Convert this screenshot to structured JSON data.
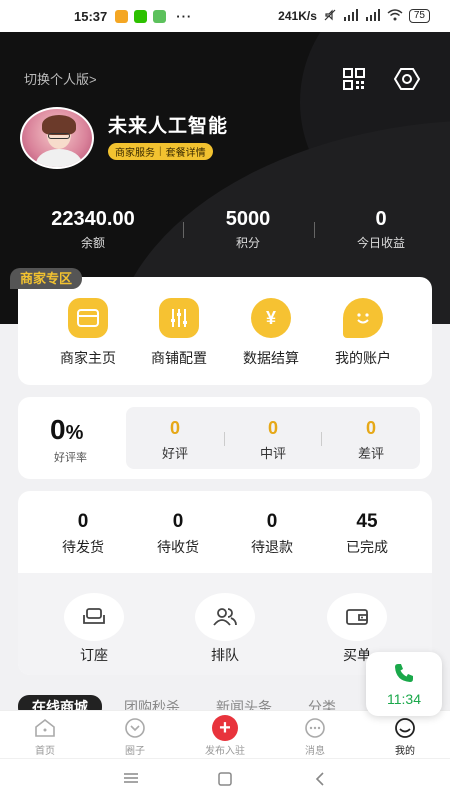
{
  "status_bar": {
    "time": "15:37",
    "dots": "···",
    "speed": "241K/s",
    "battery": "75"
  },
  "header": {
    "switch_label": "切换个人版>",
    "shop_name": "未来人工智能",
    "badge_left": "商家服务",
    "badge_sep": "|",
    "badge_right": "套餐详情",
    "stats": [
      {
        "value": "22340.00",
        "label": "余额"
      },
      {
        "value": "5000",
        "label": "积分"
      },
      {
        "value": "0",
        "label": "今日收益"
      }
    ]
  },
  "merchant_zone": {
    "tag": "商家专区",
    "items": [
      {
        "label": "商家主页",
        "icon": "storefront-icon"
      },
      {
        "label": "商铺配置",
        "icon": "sliders-icon"
      },
      {
        "label": "数据结算",
        "icon": "yen-icon"
      },
      {
        "label": "我的账户",
        "icon": "smile-icon"
      }
    ]
  },
  "reviews": {
    "rate_value": "0",
    "rate_unit": "%",
    "rate_label": "好评率",
    "items": [
      {
        "value": "0",
        "label": "好评"
      },
      {
        "value": "0",
        "label": "中评"
      },
      {
        "value": "0",
        "label": "差评"
      }
    ]
  },
  "orders": {
    "items": [
      {
        "value": "0",
        "label": "待发货"
      },
      {
        "value": "0",
        "label": "待收货"
      },
      {
        "value": "0",
        "label": "待退款"
      },
      {
        "value": "45",
        "label": "已完成"
      }
    ],
    "tools": [
      {
        "label": "订座",
        "icon": "sofa-icon"
      },
      {
        "label": "排队",
        "icon": "people-icon"
      },
      {
        "label": "买单",
        "icon": "wallet-icon"
      }
    ]
  },
  "tabs": [
    "在线商城",
    "团购秒杀",
    "新闻头条",
    "分类"
  ],
  "call": {
    "time": "11:34"
  },
  "bottom_nav": [
    {
      "label": "首页",
      "icon": "home-icon"
    },
    {
      "label": "圈子",
      "icon": "circle-icon"
    },
    {
      "label": "发布入驻",
      "icon": "plus-icon"
    },
    {
      "label": "消息",
      "icon": "message-icon"
    },
    {
      "label": "我的",
      "icon": "profile-icon"
    }
  ],
  "colors": {
    "accent": "#f6c232",
    "dark": "#111111",
    "review_num": "#e6a817",
    "call_green": "#1aa84a"
  }
}
